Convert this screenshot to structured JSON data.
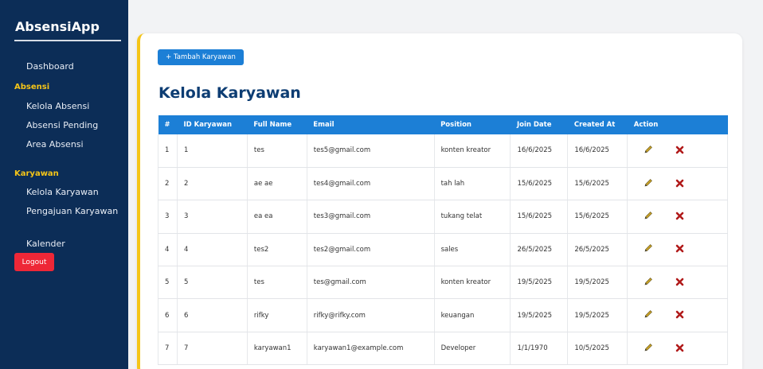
{
  "sidebar": {
    "brand": "AbsensiApp",
    "dashboard": "Dashboard",
    "section_absensi": "Absensi",
    "kelola_absensi": "Kelola Absensi",
    "absensi_pending": "Absensi Pending",
    "area_absensi": "Area Absensi",
    "section_karyawan": "Karyawan",
    "kelola_karyawan": "Kelola Karyawan",
    "pengajuan_karyawan": "Pengajuan Karyawan",
    "kalender": "Kalender",
    "logout": "Logout"
  },
  "main": {
    "add_button": "+ Tambah Karyawan",
    "title": "Kelola Karyawan"
  },
  "table": {
    "headers": [
      "#",
      "ID Karyawan",
      "Full Name",
      "Email",
      "Position",
      "Join Date",
      "Created At",
      "Action"
    ],
    "rows": [
      [
        "1",
        "1",
        "tes",
        "tes5@gmail.com",
        "konten kreator",
        "16/6/2025",
        "16/6/2025"
      ],
      [
        "2",
        "2",
        "ae ae",
        "tes4@gmail.com",
        "tah lah",
        "15/6/2025",
        "15/6/2025"
      ],
      [
        "3",
        "3",
        "ea ea",
        "tes3@gmail.com",
        "tukang telat",
        "15/6/2025",
        "15/6/2025"
      ],
      [
        "4",
        "4",
        "tes2",
        "tes2@gmail.com",
        "sales",
        "26/5/2025",
        "26/5/2025"
      ],
      [
        "5",
        "5",
        "tes",
        "tes@gmail.com",
        "konten kreator",
        "19/5/2025",
        "19/5/2025"
      ],
      [
        "6",
        "6",
        "rifky",
        "rifky@rifky.com",
        "keuangan",
        "19/5/2025",
        "19/5/2025"
      ],
      [
        "7",
        "7",
        "karyawan1",
        "karyawan1@example.com",
        "Developer",
        "1/1/1970",
        "10/5/2025"
      ]
    ]
  },
  "colors": {
    "sidebar_bg": "#0c2d57",
    "accent_yellow": "#f5c518",
    "primary_blue": "#1c7fd6",
    "title_blue": "#0d3d73",
    "logout_red": "#ee2737",
    "delete_red": "#b11a1a",
    "edit_pencil": "#c9a227"
  },
  "icons": {
    "edit": "pencil-icon",
    "delete": "close-x-icon"
  }
}
